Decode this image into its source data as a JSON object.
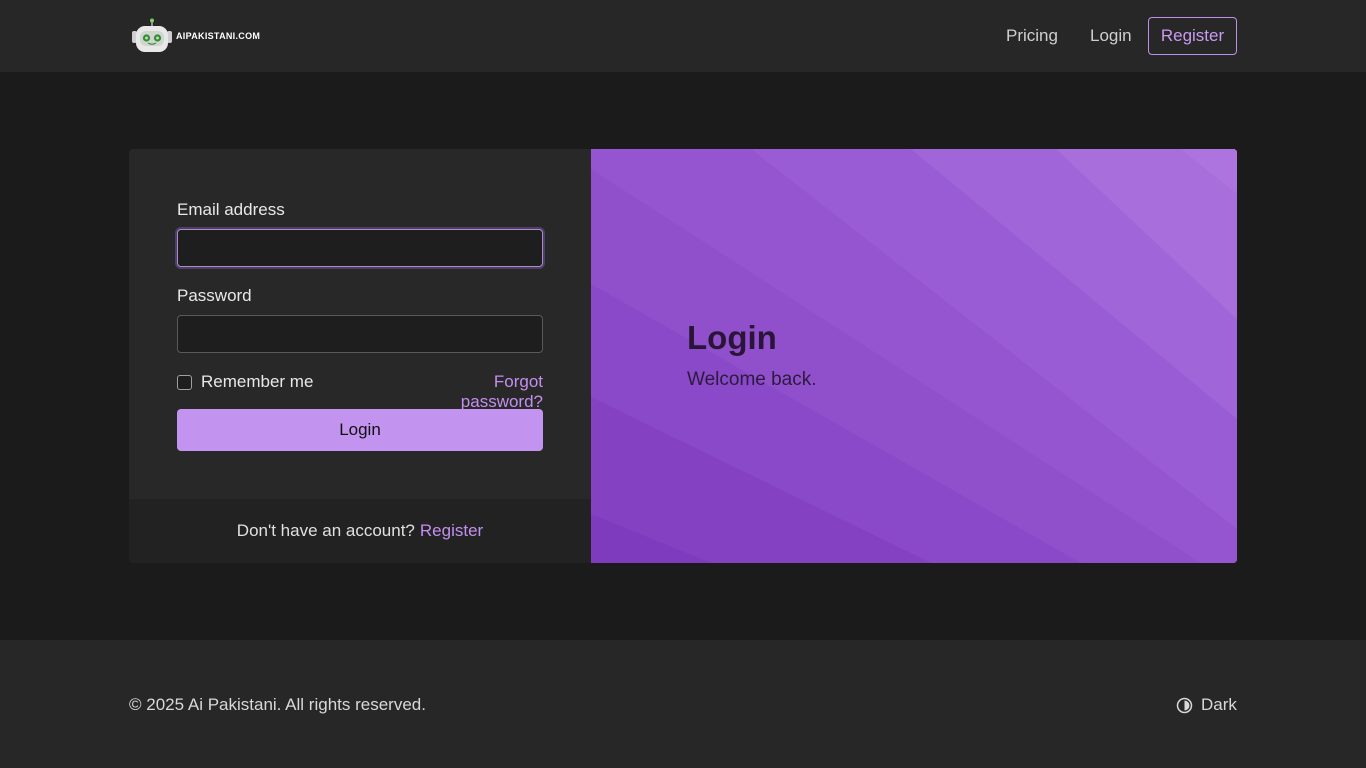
{
  "nav": {
    "logo_text": "AIPAKISTANI.COM",
    "pricing": "Pricing",
    "login": "Login",
    "register": "Register"
  },
  "form": {
    "email_label": "Email address",
    "email_value": "",
    "password_label": "Password",
    "password_value": "",
    "remember_label": "Remember me",
    "forgot_label": "Forgot password?",
    "submit_label": "Login",
    "footer_text": "Don't have an account?",
    "footer_link": "Register"
  },
  "hero": {
    "title": "Login",
    "subtitle": "Welcome back."
  },
  "footer": {
    "copyright": "© 2025 Ai Pakistani. All rights reserved.",
    "theme_label": "Dark"
  },
  "colors": {
    "accent": "#c394ef",
    "hero_bg": "#8a4ac9",
    "page_bg": "#1b1b1b"
  },
  "icons": {
    "logo": "robot-icon",
    "theme": "contrast-icon"
  }
}
